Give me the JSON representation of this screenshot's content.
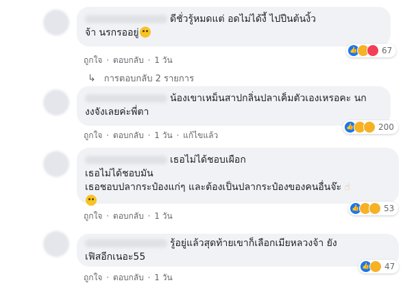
{
  "colors": {
    "bubble_bg": "#f0f2f5",
    "like": "#1877f2",
    "haha": "#f7b125",
    "love": "#f33e58",
    "meta_text": "#65676b"
  },
  "comments": [
    {
      "text": "ดีชั่วรู้หมดแต่ อดไม่ได้งี้ ไปปีนต้นงิ้ว\nจ้า นรกรออยู่",
      "actions": {
        "like": "ถูกใจ",
        "reply": "ตอบกลับ",
        "time": "1 วัน"
      },
      "reactions": {
        "icons": [
          "like-icon",
          "haha-icon",
          "love-icon"
        ],
        "count": "67"
      },
      "replies": "การตอบกลับ 2 รายการ"
    },
    {
      "text": "น้องเขาเหม็นสาปกลิ่นปลาเค็มตัวเองเหรอคะ นก\nงงจังเลยค่ะพี่ตา",
      "actions": {
        "like": "ถูกใจ",
        "reply": "ตอบกลับ",
        "time": "1 วัน",
        "edited": "แก้ไขแล้ว"
      },
      "reactions": {
        "icons": [
          "like-icon",
          "haha-icon",
          "sad-icon"
        ],
        "count": "200"
      }
    },
    {
      "text": "เธอไม่ได้ชอบเผือก\nเธอไม่ได้ชอบมัน\nเธอชอบปลากระป๋องแก่ๆ และต้องเป็นปลากระป๋องของคนอื่นจ๊ะ",
      "actions": {
        "like": "ถูกใจ",
        "reply": "ตอบกลับ",
        "time": "1 วัน"
      },
      "reactions": {
        "icons": [
          "like-icon",
          "haha-icon",
          "sad-icon"
        ],
        "count": "53"
      }
    },
    {
      "text": "รู้อยู่แล้วสุดท้ายเขาก็เลือกเมียหลวงจ้า  ยัง\nเฟิสอีกเนอะ55",
      "actions": {
        "like": "ถูกใจ",
        "reply": "ตอบกลับ",
        "time": "1 วัน"
      },
      "reactions": {
        "icons": [
          "like-icon",
          "haha-icon"
        ],
        "count": "47"
      }
    }
  ],
  "separator": "·"
}
